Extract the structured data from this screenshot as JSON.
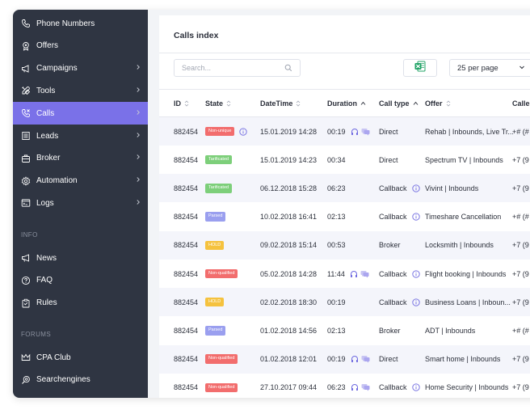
{
  "sidebar": {
    "items": [
      {
        "label": "Phone Numbers",
        "icon": "phone-icon",
        "chevron": false
      },
      {
        "label": "Offers",
        "icon": "badge-icon",
        "chevron": false
      },
      {
        "label": "Campaigns",
        "icon": "megaphone-icon",
        "chevron": true
      },
      {
        "label": "Tools",
        "icon": "tools-icon",
        "chevron": true
      },
      {
        "label": "Calls",
        "icon": "call-icon",
        "chevron": true,
        "active": true
      },
      {
        "label": "Leads",
        "icon": "list-icon",
        "chevron": true
      },
      {
        "label": "Broker",
        "icon": "briefcase-icon",
        "chevron": true
      },
      {
        "label": "Automation",
        "icon": "gear-icon",
        "chevron": true
      },
      {
        "label": "Logs",
        "icon": "terminal-icon",
        "chevron": true
      }
    ],
    "info_title": "INFO",
    "info_items": [
      {
        "label": "News",
        "icon": "megaphone-outline-icon"
      },
      {
        "label": "FAQ",
        "icon": "question-icon"
      },
      {
        "label": "Rules",
        "icon": "clipboard-icon"
      }
    ],
    "forums_title": "FORUMS",
    "forums_items": [
      {
        "label": "CPA Club",
        "icon": "crown-icon"
      },
      {
        "label": "Searchengines",
        "icon": "search-target-icon"
      }
    ]
  },
  "main": {
    "title": "Calls index",
    "search_placeholder": "Search...",
    "per_page": "25 per page",
    "columns": [
      "ID",
      "State",
      "DateTime",
      "Duration",
      "Call type",
      "Offer",
      "Caller"
    ],
    "rows": [
      {
        "id": "882454",
        "state": "Non-unique",
        "state_color": "#f26d6d",
        "datetime": "15.01.2019 14:28",
        "duration": "00:19",
        "media": true,
        "call_type": "Direct",
        "call_info": false,
        "offer": "Rehab | Inbounds, Live Tr...",
        "caller": "+# (#"
      },
      {
        "id": "882454",
        "state": "Tarificated",
        "state_color": "#7dcf7a",
        "datetime": "15.01.2019 14:23",
        "duration": "00:34",
        "media": false,
        "call_type": "Direct",
        "call_info": false,
        "offer": "Spectrum TV | Inbounds",
        "caller": "+7 (9"
      },
      {
        "id": "882454",
        "state": "Tarificated",
        "state_color": "#7dcf7a",
        "datetime": "06.12.2018 15:28",
        "duration": "06:23",
        "media": false,
        "call_type": "Callback",
        "call_info": true,
        "offer": "Vivint | Inbounds",
        "caller": "+7 (9"
      },
      {
        "id": "882454",
        "state": "Parsed",
        "state_color": "#9a9fef",
        "datetime": "10.02.2018 16:41",
        "duration": "02:13",
        "media": false,
        "call_type": "Callback",
        "call_info": true,
        "offer": "Timeshare Cancellation",
        "caller": "+# (#"
      },
      {
        "id": "882454",
        "state": "HOLD",
        "state_color": "#f5c23e",
        "datetime": "09.02.2018 15:14",
        "duration": "00:53",
        "media": false,
        "call_type": "Broker",
        "call_info": false,
        "offer": "Locksmith | Inbounds",
        "caller": "+7 (9"
      },
      {
        "id": "882454",
        "state": "Non-qualified",
        "state_color": "#f26d6d",
        "datetime": "05.02.2018 14:28",
        "duration": "11:44",
        "media": true,
        "call_type": "Callback",
        "call_info": true,
        "offer": "Flight booking | Inbounds",
        "caller": "+7 (9"
      },
      {
        "id": "882454",
        "state": "HOLD",
        "state_color": "#f5c23e",
        "datetime": "02.02.2018 18:30",
        "duration": "00:19",
        "media": false,
        "call_type": "Callback",
        "call_info": true,
        "offer": "Business Loans | Inboun...",
        "caller": "+7 (9"
      },
      {
        "id": "882454",
        "state": "Parsed",
        "state_color": "#9a9fef",
        "datetime": "01.02.2018 14:56",
        "duration": "02:13",
        "media": false,
        "call_type": "Broker",
        "call_info": false,
        "offer": "ADT | Inbounds",
        "caller": "+# (#"
      },
      {
        "id": "882454",
        "state": "Non-qualified",
        "state_color": "#f26d6d",
        "datetime": "01.02.2018 12:01",
        "duration": "00:19",
        "media": true,
        "call_type": "Direct",
        "call_info": false,
        "offer": "Smart home | Inbounds",
        "caller": "+7 (9"
      },
      {
        "id": "882454",
        "state": "Non-qualified",
        "state_color": "#f26d6d",
        "datetime": "27.10.2017 09:44",
        "duration": "06:23",
        "media": true,
        "call_type": "Callback",
        "call_info": true,
        "offer": "Home Security | Inbounds",
        "caller": "+7 (9"
      }
    ]
  },
  "colors": {
    "accent": "#7a71e8",
    "sidebar_bg": "#2f3542",
    "excel_green": "#21a366"
  }
}
